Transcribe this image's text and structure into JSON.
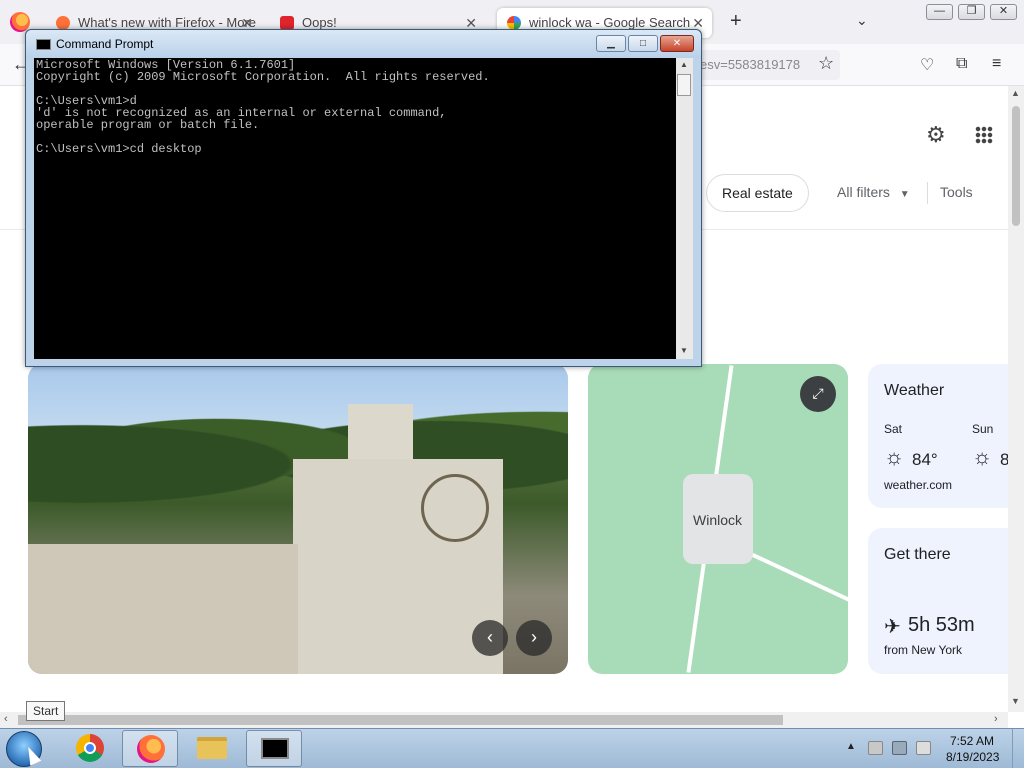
{
  "browser": {
    "tabs": [
      {
        "title": "What's new with Firefox - More",
        "favicon_color": "#ff7139"
      },
      {
        "title": "Oops!",
        "favicon_color": "#e0242b"
      },
      {
        "title": "winlock wa - Google Search",
        "favicon_color": "#4285f4"
      }
    ],
    "active_tab_index": 2,
    "url_visible": "esv=5583819178",
    "window_buttons": {
      "minimize": "—",
      "restore": "❐",
      "close": "✕"
    }
  },
  "page": {
    "chips": {
      "real_estate": "Real estate",
      "all_filters": "All filters",
      "tools": "Tools"
    },
    "map_label": "Winlock",
    "weather": {
      "title": "Weather",
      "days": [
        {
          "day": "Sat",
          "temp": "84°"
        },
        {
          "day": "Sun",
          "temp": "8"
        }
      ],
      "source": "weather.com"
    },
    "get_there": {
      "title": "Get there",
      "duration": "5h 53m",
      "from": "from New York"
    }
  },
  "cmd": {
    "title": "Command Prompt",
    "lines": [
      "Microsoft Windows [Version 6.1.7601]",
      "Copyright (c) 2009 Microsoft Corporation.  All rights reserved.",
      "",
      "C:\\Users\\vm1>d",
      "'d' is not recognized as an internal or external command,",
      "operable program or batch file.",
      "",
      "C:\\Users\\vm1>cd desktop"
    ]
  },
  "taskbar": {
    "tooltip": "Start",
    "clock_time": "7:52 AM",
    "clock_date": "8/19/2023"
  },
  "colors": {
    "accent": "#4285f4",
    "card_bg": "#eef3fd",
    "map_green": "#a8dbb8",
    "console_text": "#c0c0c0"
  }
}
